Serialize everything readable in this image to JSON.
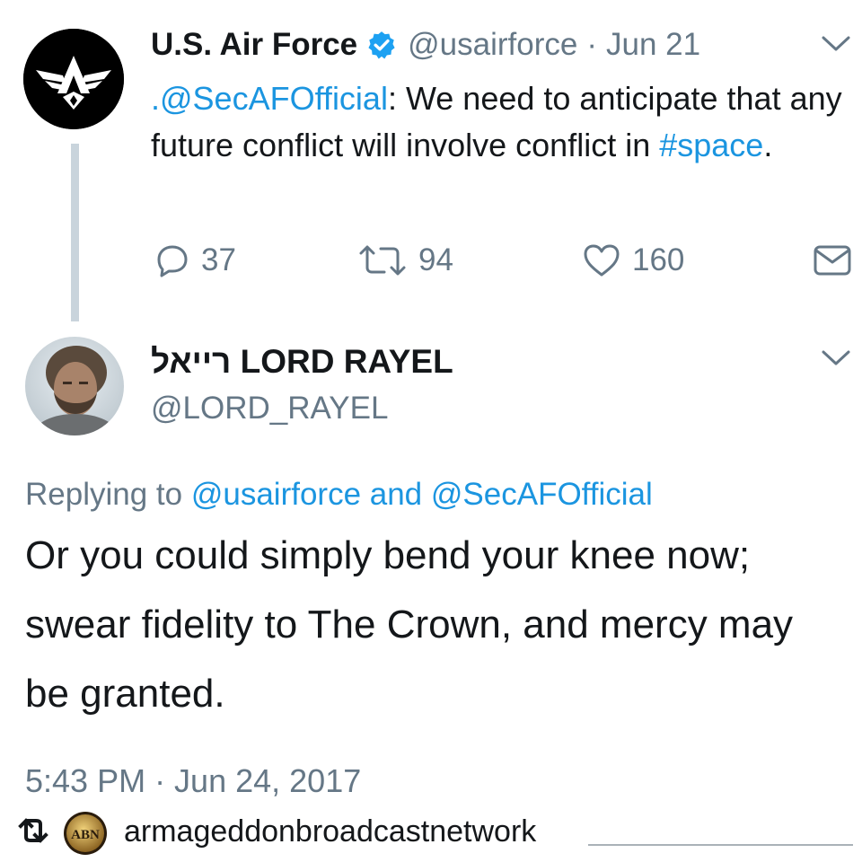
{
  "tweet1": {
    "name": "U.S. Air Force",
    "handle": "@usairforce",
    "separator": "·",
    "date": "Jun 21",
    "mention": ".@SecAFOfficial",
    "text_main": ": We need to anticipate that any future conflict will involve conflict in ",
    "hashtag": "#space",
    "text_end": ".",
    "replies": "37",
    "retweets": "94",
    "likes": "160",
    "avatar_icon": "air-force-wings-logo",
    "verified_icon": "verified-badge"
  },
  "tweet2": {
    "name": "רייאל LORD RAYEL",
    "handle": "@LORD_RAYEL",
    "replying_prefix": "Replying to ",
    "replying_user1": "@usairforce",
    "replying_and": " and ",
    "replying_user2": "@SecAFOfficial",
    "text": "Or you could simply bend your knee now; swear fidelity to The Crown, and mercy may be granted.",
    "timestamp": "5:43 PM · Jun 24, 2017"
  },
  "repost": {
    "username": "armageddonbroadcastnetwork",
    "logo_text": "ABN"
  },
  "colors": {
    "link": "#1b95e0",
    "secondary_text": "#657786",
    "thread_line": "#c9d4dc",
    "verified": "#1da1f2"
  }
}
